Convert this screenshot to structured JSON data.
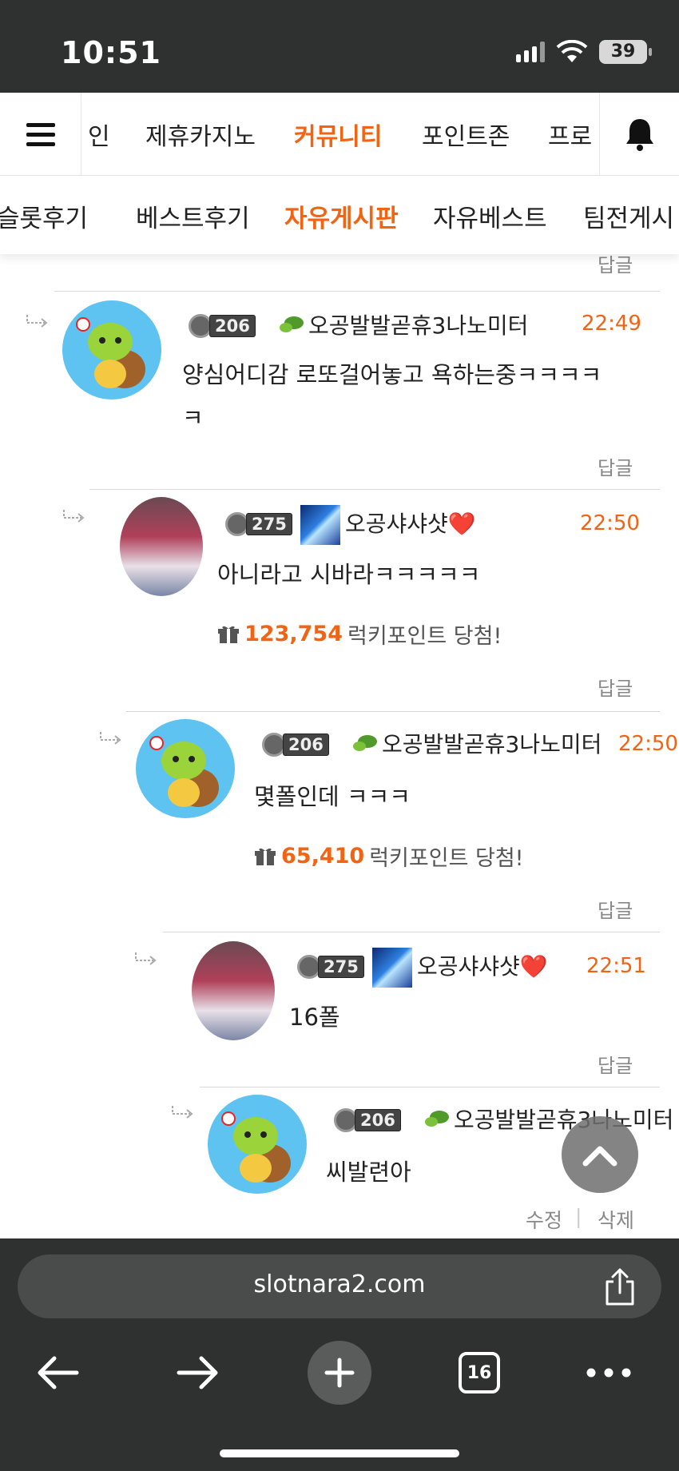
{
  "status_bar": {
    "time": "10:51",
    "battery": "39"
  },
  "nav": {
    "items": [
      "인",
      "제휴카지노",
      "커뮤니티",
      "포인트존",
      "프로"
    ],
    "active_index": 2
  },
  "subnav": {
    "items": [
      "슬롯후기",
      "베스트후기",
      "자유게시판",
      "자유베스트",
      "팀전게시"
    ],
    "active_index": 2
  },
  "reply_label": "답글",
  "comments": [
    {
      "level": "206",
      "nickname": "오공발발곧휴3나노미터",
      "time": "22:49",
      "text_line1": "양심어디감 로또걸어놓고 욕하는중ㅋㅋㅋㅋ",
      "text_line2": "ㅋ"
    },
    {
      "level": "275",
      "nickname": "오공샤샤샷",
      "heart": "❤️",
      "time": "22:50",
      "text_line1": "아니라고 시바라ㅋㅋㅋㅋㅋ",
      "lucky_amount": "123,754",
      "lucky_text": "럭키포인트 당첨!"
    },
    {
      "level": "206",
      "nickname": "오공발발곧휴3나노미터",
      "time": "22:50",
      "text_line1": "몇폴인데 ㅋㅋㅋ",
      "lucky_amount": "65,410",
      "lucky_text": "럭키포인트 당첨!"
    },
    {
      "level": "275",
      "nickname": "오공샤샤샷",
      "heart": "❤️",
      "time": "22:51",
      "text_line1": "16폴"
    },
    {
      "level": "206",
      "nickname": "오공발발곧휴3나노미터",
      "text_line1": "씨발련아"
    }
  ],
  "actions": {
    "edit": "수정",
    "separator": "|",
    "delete": "삭제"
  },
  "browser": {
    "url": "slotnara2.com",
    "tab_count": "16"
  }
}
